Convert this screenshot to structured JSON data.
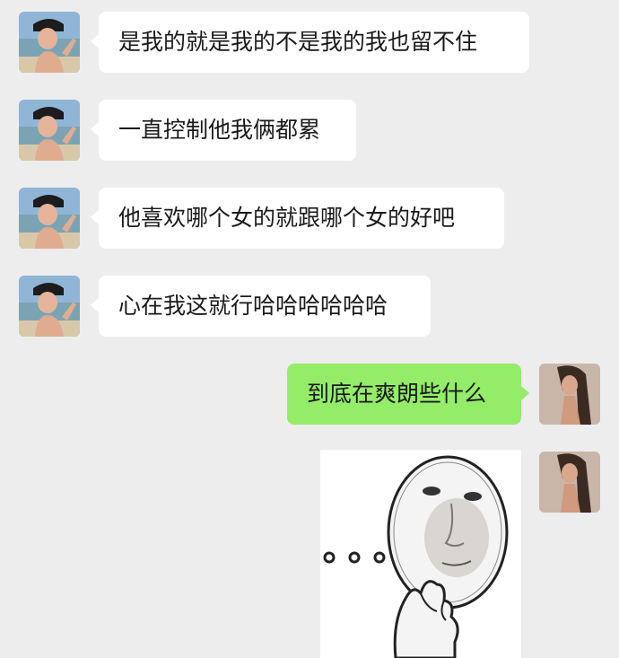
{
  "colors": {
    "background": "#ededed",
    "incoming_bubble": "#ffffff",
    "outgoing_bubble": "#95ec69"
  },
  "messages": [
    {
      "side": "left",
      "sender": "contact-avatar",
      "text": "是我的就是我的不是我的我也留不住"
    },
    {
      "side": "left",
      "sender": "contact-avatar",
      "text": "一直控制他我俩都累"
    },
    {
      "side": "left",
      "sender": "contact-avatar",
      "text": "他喜欢哪个女的就跟哪个女的好吧"
    },
    {
      "side": "left",
      "sender": "contact-avatar",
      "text": "心在我这就行哈哈哈哈哈哈"
    },
    {
      "side": "right",
      "sender": "self-avatar",
      "text": "到底在爽朗些什么"
    },
    {
      "side": "right",
      "sender": "self-avatar",
      "type": "sticker",
      "sticker": "thinking-face-meme"
    }
  ]
}
